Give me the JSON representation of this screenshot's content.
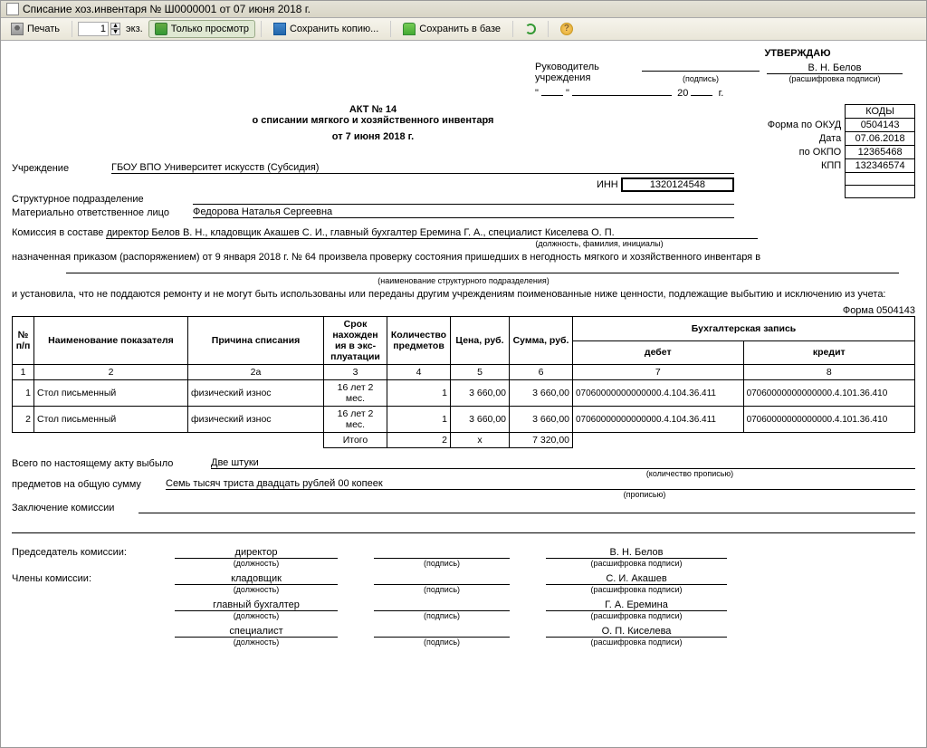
{
  "window": {
    "title": "Списание хоз.инвентаря № Ш0000001 от 07 июня 2018 г."
  },
  "toolbar": {
    "print": "Печать",
    "copies": "1",
    "copies_unit": "экз.",
    "view_only": "Только просмотр",
    "save_copy": "Сохранить копию...",
    "save_db": "Сохранить в базе"
  },
  "approve": {
    "title": "УТВЕРЖДАЮ",
    "head_label": "Руководитель учреждения",
    "head_name": "В. Н. Белов",
    "sign_cap": "(подпись)",
    "decode_cap": "(расшифровка подписи)",
    "date_quote1": "\"",
    "date_quote2": "\"",
    "year_suffix": "20",
    "year_g": "г."
  },
  "act": {
    "title": "АКТ № 14",
    "subtitle": "о списании мягкого и хозяйственного инвентаря",
    "date_line": "от 7 июня 2018 г."
  },
  "codes": {
    "header": "КОДЫ",
    "okud_label": "Форма  по ОКУД",
    "okud": "0504143",
    "date_label": "Дата",
    "date": "07.06.2018",
    "okpo_label": "по ОКПО",
    "okpo": "12365468",
    "kpp_label": "КПП",
    "kpp": "132346574"
  },
  "org": {
    "label": "Учреждение",
    "value": "ГБОУ ВПО Университет искусств (Субсидия)",
    "inn_label": "ИНН",
    "inn": "1320124548",
    "struct_label": "Структурное подразделение",
    "mol_label": "Материально ответственное лицо",
    "mol": "Федорова Наталья Сергеевна"
  },
  "commission": {
    "intro": "Комиссия в составе",
    "members": "директор Белов В. Н., кладовщик Акашев С. И., главный бухгалтер Еремина  Г. А., специалист Киселева О. П.",
    "caption": "(должность, фамилия, инициалы)",
    "order_part1": "назначенная приказом (распоряжением) от  9 января 2018 г.   № 64   произвела проверку состояния пришедших в негодность мягкого и хозяйственного инвентаря в",
    "where_cap": "(наименование структурного подразделения)",
    "finding": "и установила, что не поддаются ремонту и не могут быть использованы или переданы другим учреждениям поименованные ниже ценности, подлежащие выбытию и исключению из учета:",
    "form_ref": "Форма 0504143"
  },
  "table": {
    "h_num": "№ п/п",
    "h_name": "Наименование показателя",
    "h_reason": "Причина списания",
    "h_term": "Срок нахожден ия в экс- плуатации",
    "h_qty": "Количество предметов",
    "h_price": "Цена, руб.",
    "h_sum": "Сумма, руб.",
    "h_acc": "Бухгалтерская запись",
    "h_debit": "дебет",
    "h_credit": "кредит",
    "c1": "1",
    "c2": "2",
    "c2a": "2а",
    "c3": "3",
    "c4": "4",
    "c5": "5",
    "c6": "6",
    "c7": "7",
    "c8": "8",
    "rows": [
      {
        "n": "1",
        "name": "Стол письменный",
        "reason": "физический износ",
        "term": "16 лет 2 мес.",
        "qty": "1",
        "price": "3 660,00",
        "sum": "3 660,00",
        "debit": "07060000000000000.4.104.36.411",
        "credit": "07060000000000000.4.101.36.410"
      },
      {
        "n": "2",
        "name": "Стол письменный",
        "reason": "физический износ",
        "term": "16 лет 2 мес.",
        "qty": "1",
        "price": "3 660,00",
        "sum": "3 660,00",
        "debit": "07060000000000000.4.104.36.411",
        "credit": "07060000000000000.4.101.36.410"
      }
    ],
    "total_label": "Итого",
    "total_qty": "2",
    "total_price": "х",
    "total_sum": "7 320,00"
  },
  "totals_text": {
    "line1_label": "Всего по настоящему акту выбыло",
    "line1_val": "Две штуки",
    "line1_cap": "(количество прописью)",
    "line2_label": "предметов на общую сумму",
    "line2_val": "Семь тысяч триста двадцать рублей 00 копеек",
    "line2_cap": "(прописью)",
    "conclusion_label": "Заключение комиссии"
  },
  "signatures": {
    "chair_label": "Председатель комиссии:",
    "members_label": "Члены комиссии:",
    "pos_cap": "(должность)",
    "sign_cap": "(подпись)",
    "decode_cap": "(расшифровка подписи)",
    "rows": [
      {
        "pos": "директор",
        "name": "В. Н. Белов"
      },
      {
        "pos": "кладовщик",
        "name": "С. И. Акашев"
      },
      {
        "pos": "главный бухгалтер",
        "name": "Г. А. Еремина"
      },
      {
        "pos": "специалист",
        "name": "О. П. Киселева"
      }
    ]
  }
}
